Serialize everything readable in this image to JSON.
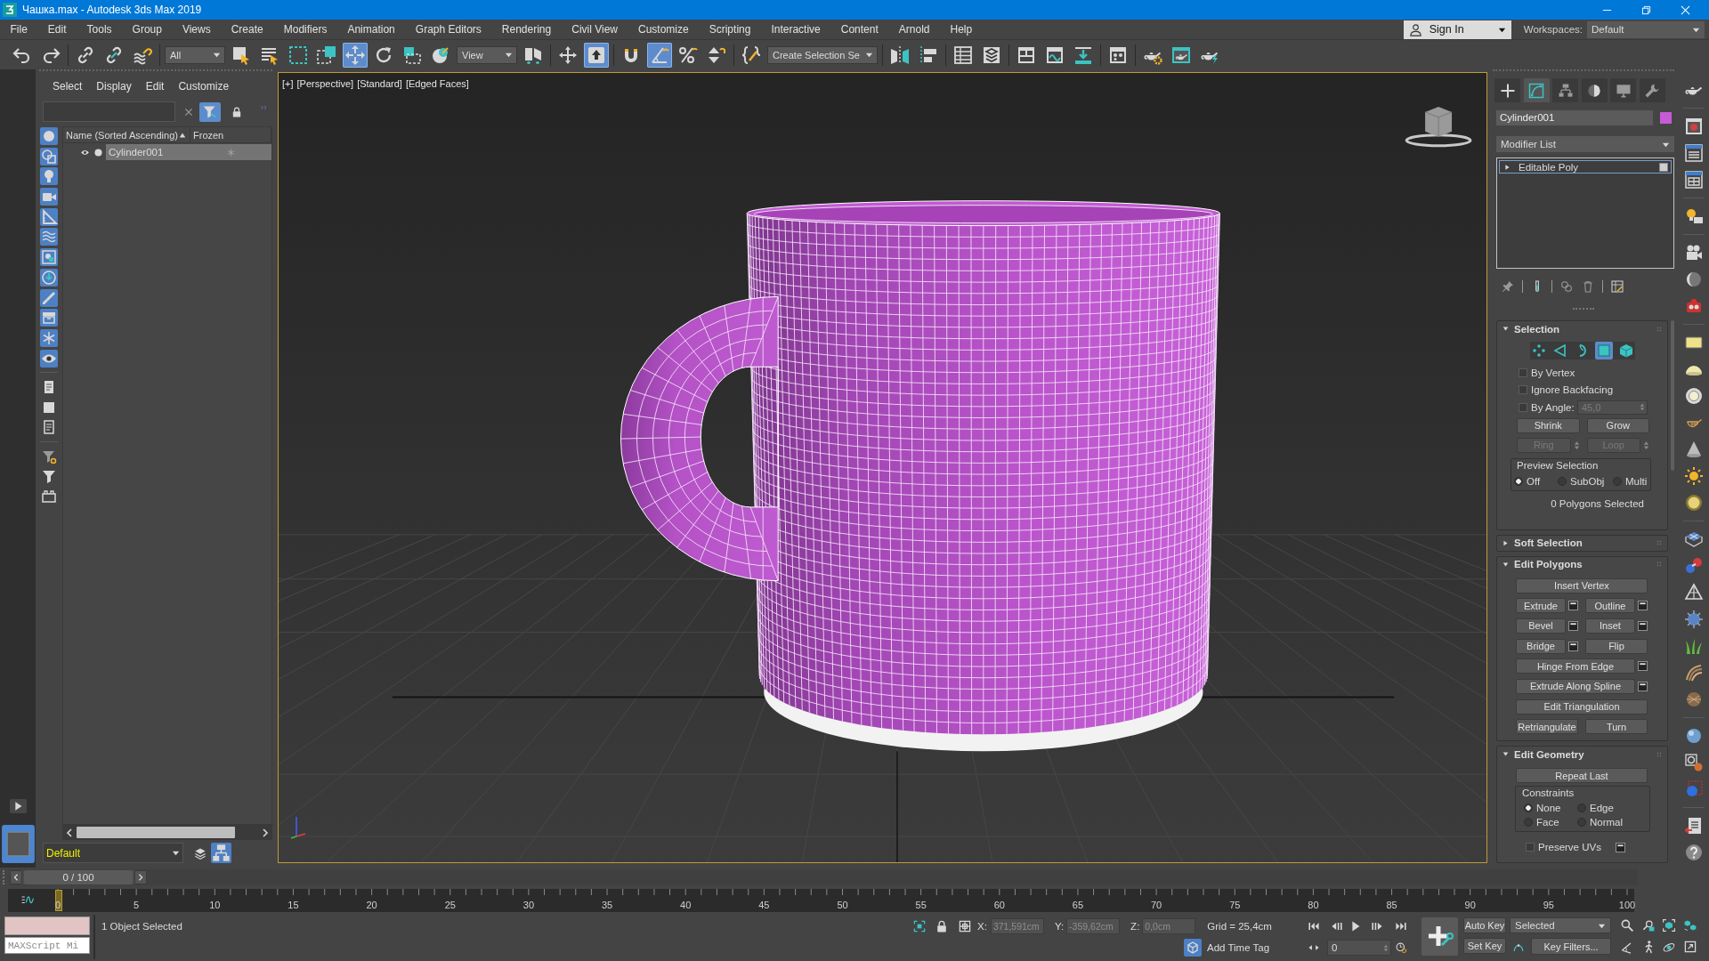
{
  "window": {
    "title": "Чашка.max - Autodesk 3ds Max 2019"
  },
  "menu_bar": {
    "items": [
      "File",
      "Edit",
      "Tools",
      "Group",
      "Views",
      "Create",
      "Modifiers",
      "Animation",
      "Graph Editors",
      "Rendering",
      "Civil View",
      "Customize",
      "Scripting",
      "Interactive",
      "Content",
      "Arnold",
      "Help"
    ],
    "sign_in": "Sign In",
    "workspaces_label": "Workspaces:",
    "workspace": "Default"
  },
  "main_toolbar": {
    "items": [
      {
        "kind": "button",
        "selected": false
      },
      {
        "kind": "button",
        "selected": false
      },
      {
        "kind": "button",
        "selected": false
      },
      {
        "kind": "button",
        "selected": false
      },
      {
        "kind": "button",
        "selected": false
      },
      {
        "kind": "dropdown",
        "value": "All"
      },
      {
        "kind": "button",
        "selected": false
      },
      {
        "kind": "button",
        "selected": false
      },
      {
        "kind": "button",
        "selected": false
      },
      {
        "kind": "button",
        "selected": false
      },
      {
        "kind": "button",
        "selected": true
      },
      {
        "kind": "button",
        "selected": false
      },
      {
        "kind": "button",
        "selected": false
      },
      {
        "kind": "button",
        "selected": false
      },
      {
        "kind": "dropdown",
        "value": "View"
      },
      {
        "kind": "button",
        "selected": false
      },
      {
        "kind": "button",
        "selected": false
      },
      {
        "kind": "button",
        "selected": true
      },
      {
        "kind": "button",
        "selected": false
      },
      {
        "kind": "button",
        "selected": true
      },
      {
        "kind": "button",
        "selected": false
      },
      {
        "kind": "button",
        "selected": false
      },
      {
        "kind": "button",
        "selected": false
      },
      {
        "kind": "dropdown",
        "value": "Create Selection Se"
      },
      {
        "kind": "button",
        "selected": false
      },
      {
        "kind": "button",
        "selected": false
      },
      {
        "kind": "button",
        "selected": false
      },
      {
        "kind": "button",
        "selected": false
      },
      {
        "kind": "button",
        "selected": false
      },
      {
        "kind": "button",
        "selected": false
      },
      {
        "kind": "button",
        "selected": false
      },
      {
        "kind": "button",
        "selected": false
      },
      {
        "kind": "button",
        "selected": false
      },
      {
        "kind": "button",
        "selected": false
      },
      {
        "kind": "button",
        "selected": false
      }
    ]
  },
  "scene_explorer": {
    "menu": [
      "Select",
      "Display",
      "Edit",
      "Customize"
    ],
    "filter_on": true,
    "display_filters": [
      {
        "on": true
      },
      {
        "on": true
      },
      {
        "on": true
      },
      {
        "on": true
      },
      {
        "on": true
      },
      {
        "on": true
      },
      {
        "on": true
      },
      {
        "on": true
      },
      {
        "on": true
      },
      {
        "on": true
      },
      {
        "on": true
      },
      {
        "on": true
      }
    ],
    "columns": [
      "Name (Sorted Ascending)",
      "Frozen"
    ],
    "rows": [
      {
        "name": "Cylinder001",
        "visible": true,
        "frozen": false,
        "selected": true
      }
    ],
    "layer": "Default"
  },
  "viewport": {
    "active": true,
    "labels": [
      "[+]",
      "[Perspective]",
      "[Standard]",
      "[Edged Faces]"
    ]
  },
  "command_panel": {
    "tabs": [
      {
        "selected": false
      },
      {
        "selected": true
      },
      {
        "selected": false
      },
      {
        "selected": false
      },
      {
        "selected": false
      },
      {
        "selected": false
      }
    ],
    "object_name": "Cylinder001",
    "modifier_list": "Modifier List",
    "stack": [
      {
        "name": "Editable Poly",
        "expanded": false,
        "selected": true
      }
    ],
    "rollouts": [
      {
        "kind": "selection",
        "title": "Selection",
        "expanded": true,
        "levels": [
          {
            "selected": false
          },
          {
            "selected": false
          },
          {
            "selected": false
          },
          {
            "selected": true
          },
          {
            "selected": false
          }
        ],
        "options": [
          {
            "label": "By Vertex",
            "checked": false
          },
          {
            "label": "Ignore Backfacing",
            "checked": false
          },
          {
            "label": "By Angle:",
            "checked": false,
            "value": "45,0"
          }
        ],
        "rows": [
          [
            {
              "label": "Shrink",
              "disabled": false,
              "spinner": false
            },
            {
              "label": "Grow",
              "disabled": false,
              "spinner": false
            }
          ],
          [
            {
              "label": "Ring",
              "disabled": true,
              "spinner": true
            },
            {
              "label": "Loop",
              "disabled": true,
              "spinner": true
            }
          ]
        ],
        "preview": {
          "title": "Preview Selection",
          "options": [
            {
              "label": "Off",
              "selected": true
            },
            {
              "label": "SubObj",
              "selected": false
            },
            {
              "label": "Multi",
              "selected": false
            }
          ]
        },
        "status": "0 Polygons Selected"
      },
      {
        "kind": "simple",
        "title": "Soft Selection",
        "expanded": false
      },
      {
        "kind": "buttons",
        "title": "Edit Polygons",
        "expanded": true,
        "rows": [
          [
            {
              "label": "Insert Vertex",
              "settings": false
            }
          ],
          [
            {
              "label": "Extrude",
              "settings": true
            },
            {
              "label": "Outline",
              "settings": true
            }
          ],
          [
            {
              "label": "Bevel",
              "settings": true
            },
            {
              "label": "Inset",
              "settings": true
            }
          ],
          [
            {
              "label": "Bridge",
              "settings": true
            },
            {
              "label": "Flip",
              "settings": false
            }
          ],
          [
            {
              "label": "Hinge From Edge",
              "settings": true
            }
          ],
          [
            {
              "label": "Extrude Along Spline",
              "settings": true
            }
          ],
          [
            {
              "label": "Edit Triangulation",
              "settings": false
            }
          ],
          [
            {
              "label": "Retriangulate",
              "settings": false
            },
            {
              "label": "Turn",
              "settings": false
            }
          ]
        ]
      },
      {
        "kind": "geometry",
        "title": "Edit Geometry",
        "expanded": true,
        "rows": [
          [
            {
              "label": "Repeat Last",
              "settings": false
            }
          ]
        ],
        "constraints": {
          "title": "Constraints",
          "options": [
            {
              "label": "None",
              "selected": true
            },
            {
              "label": "Edge",
              "selected": false
            },
            {
              "label": "Face",
              "selected": false
            },
            {
              "label": "Normal",
              "selected": false
            }
          ]
        },
        "options": [
          {
            "label": "Preserve UVs",
            "checked": false,
            "settings": true
          }
        ]
      }
    ]
  },
  "time_slider": {
    "label": "0 / 100",
    "level": 0
  },
  "track_bar": {
    "labels": [
      "0",
      "5",
      "10",
      "15",
      "20",
      "25",
      "30",
      "35",
      "40",
      "45",
      "50",
      "55",
      "60",
      "65",
      "70",
      "75",
      "80",
      "85",
      "90",
      "95",
      "100"
    ]
  },
  "status_bar": {
    "listener_placeholder": "MAXScript Mi",
    "prompt": "1 Object Selected",
    "coordinates": [
      {
        "axis": "X:",
        "value": "371,591cm",
        "disabled": true
      },
      {
        "axis": "Y:",
        "value": "-359,62cm",
        "disabled": true
      },
      {
        "axis": "Z:",
        "value": "0,0cm",
        "disabled": true
      }
    ],
    "grid": "Grid = 25,4cm",
    "time_tag": "Add Time Tag",
    "frame": "0",
    "auto_key": "Auto Key",
    "set_key": "Set Key",
    "key_set": "Selected",
    "key_filters": "Key Filters..."
  }
}
